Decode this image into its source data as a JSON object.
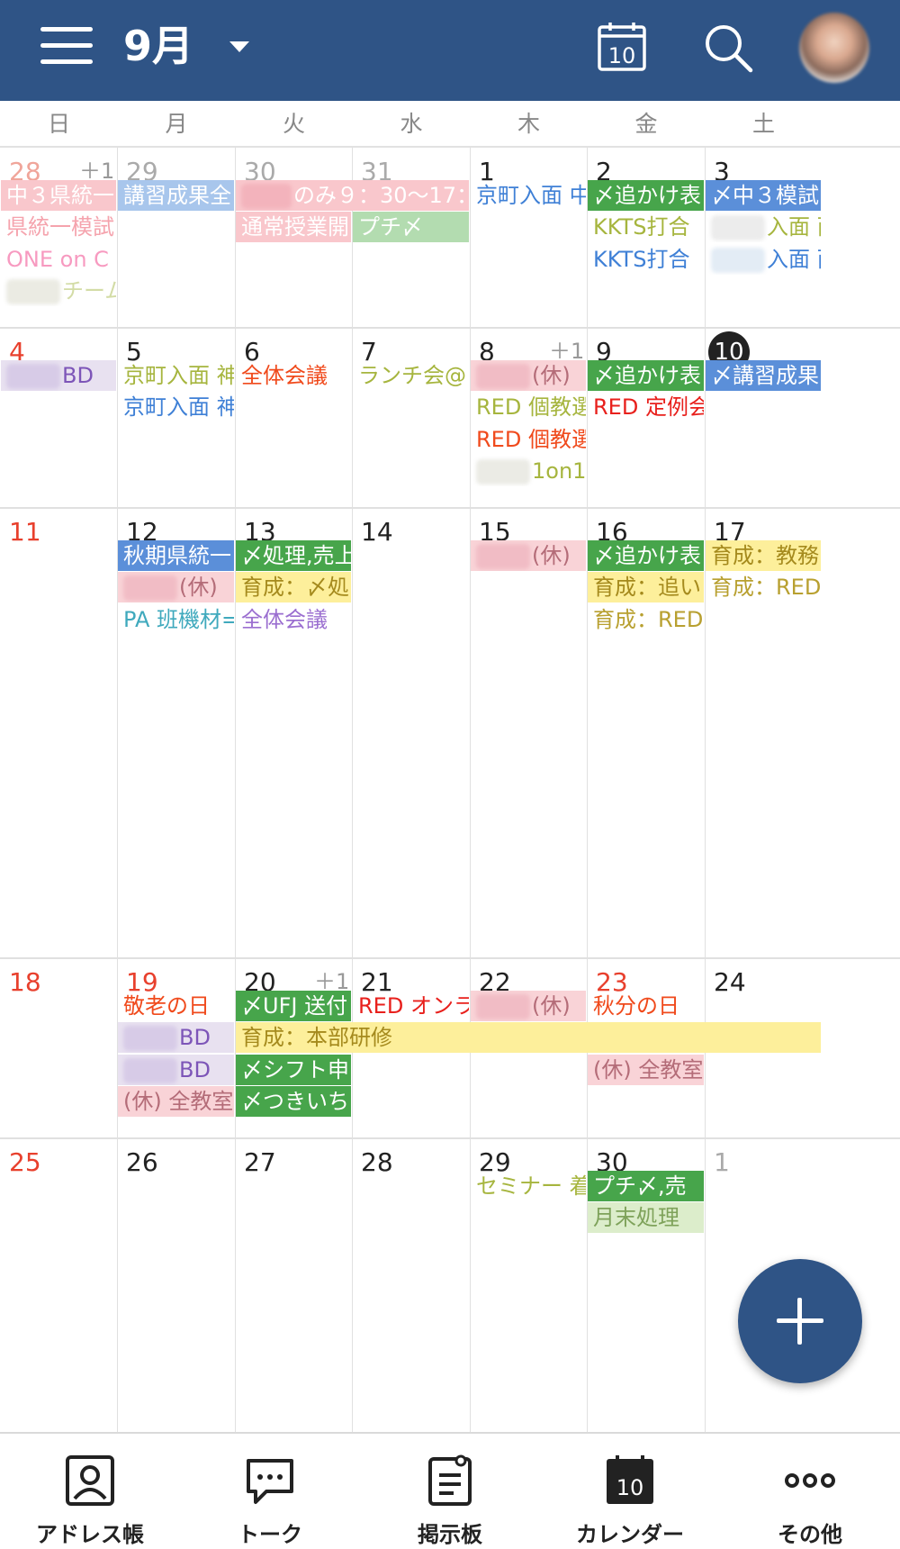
{
  "header": {
    "month": "9月",
    "today_icon_text": "10"
  },
  "weekdays": [
    "日",
    "月",
    "火",
    "水",
    "木",
    "金",
    "土"
  ],
  "weeks": [
    {
      "days": [
        {
          "n": "28",
          "muted": true,
          "red": true,
          "more": "＋1"
        },
        {
          "n": "29",
          "muted": true
        },
        {
          "n": "30",
          "muted": true
        },
        {
          "n": "31",
          "muted": true
        },
        {
          "n": "1"
        },
        {
          "n": "2"
        },
        {
          "n": "3"
        }
      ]
    },
    {
      "days": [
        {
          "n": "4",
          "red": true
        },
        {
          "n": "5"
        },
        {
          "n": "6"
        },
        {
          "n": "7"
        },
        {
          "n": "8",
          "more": "＋1"
        },
        {
          "n": "9"
        },
        {
          "n": "10",
          "today": true
        }
      ]
    },
    {
      "days": [
        {
          "n": "11",
          "red": true
        },
        {
          "n": "12"
        },
        {
          "n": "13"
        },
        {
          "n": "14"
        },
        {
          "n": "15"
        },
        {
          "n": "16"
        },
        {
          "n": "17"
        }
      ]
    },
    {
      "days": [
        {
          "n": "18",
          "red": true
        },
        {
          "n": "19",
          "red": true
        },
        {
          "n": "20",
          "more": "＋1"
        },
        {
          "n": "21"
        },
        {
          "n": "22"
        },
        {
          "n": "23",
          "red": true
        },
        {
          "n": "24"
        }
      ]
    },
    {
      "days": [
        {
          "n": "25",
          "red": true
        },
        {
          "n": "26"
        },
        {
          "n": "27"
        },
        {
          "n": "28"
        },
        {
          "n": "29"
        },
        {
          "n": "30"
        },
        {
          "n": "1",
          "muted": true
        }
      ]
    }
  ],
  "events": [
    {
      "w": 0,
      "c": 0,
      "span": 1,
      "row": 0,
      "text": "中３県統一",
      "bg": "#f9c7cc",
      "fg": "#ffffff"
    },
    {
      "w": 0,
      "c": 0,
      "span": 1,
      "row": 1,
      "text": "県統一模試",
      "bg": "",
      "fg": "#f5a3ad"
    },
    {
      "w": 0,
      "c": 0,
      "span": 1,
      "row": 2,
      "text": "ONE on C",
      "bg": "",
      "fg": "#f79ac0"
    },
    {
      "w": 0,
      "c": 0,
      "span": 1,
      "row": 3,
      "text": "チーム",
      "bg": "",
      "fg": "#d3dca6",
      "blur": "#ebebe3"
    },
    {
      "w": 0,
      "c": 1,
      "span": 1,
      "row": 0,
      "text": "講習成果全",
      "bg": "#a8c6ec",
      "fg": "#ffffff"
    },
    {
      "w": 0,
      "c": 2,
      "span": 2,
      "row": 0,
      "text": "のみ９：30～17：",
      "bg": "#f9c7cc",
      "fg": "#ffffff",
      "blur": "#f3b3bc"
    },
    {
      "w": 0,
      "c": 2,
      "span": 1,
      "row": 1,
      "text": "通常授業開",
      "bg": "#f9c7cc",
      "fg": "#ffffff"
    },
    {
      "w": 0,
      "c": 3,
      "span": 1,
      "row": 1,
      "text": "プチ〆",
      "bg": "#b3dcb0",
      "fg": "#ffffff"
    },
    {
      "w": 0,
      "c": 4,
      "span": 1,
      "row": 0,
      "text": "京町入面 中",
      "bg": "",
      "fg": "#3f80d6"
    },
    {
      "w": 0,
      "c": 5,
      "span": 1,
      "row": 0,
      "text": "〆追かけ表",
      "bg": "#47a54b",
      "fg": "#ffffff"
    },
    {
      "w": 0,
      "c": 5,
      "span": 1,
      "row": 1,
      "text": "KKTS打合",
      "bg": "",
      "fg": "#a6b53e"
    },
    {
      "w": 0,
      "c": 5,
      "span": 1,
      "row": 2,
      "text": "KKTS打合",
      "bg": "",
      "fg": "#3f80d6"
    },
    {
      "w": 0,
      "c": 6,
      "span": 1,
      "row": 0,
      "text": "〆中３模試",
      "bg": "#5b8fd9",
      "fg": "#ffffff"
    },
    {
      "w": 0,
      "c": 6,
      "span": 1,
      "row": 1,
      "text": "入面 西",
      "bg": "",
      "fg": "#a6b53e",
      "blur": "#ececec"
    },
    {
      "w": 0,
      "c": 6,
      "span": 1,
      "row": 2,
      "text": "入面 西",
      "bg": "",
      "fg": "#3f80d6",
      "blur": "#e3ecf5"
    },
    {
      "w": 1,
      "c": 0,
      "span": 1,
      "row": 0,
      "text": "BD",
      "bg": "#e8e1f0",
      "fg": "#7d55b8",
      "blur": "#d7cbe7"
    },
    {
      "w": 1,
      "c": 1,
      "span": 1,
      "row": 0,
      "text": "京町入面 神",
      "bg": "",
      "fg": "#a6b53e"
    },
    {
      "w": 1,
      "c": 1,
      "span": 1,
      "row": 1,
      "text": "京町入面 神",
      "bg": "",
      "fg": "#3f80d6"
    },
    {
      "w": 1,
      "c": 2,
      "span": 1,
      "row": 0,
      "text": "全体会議",
      "bg": "",
      "fg": "#f04a1c"
    },
    {
      "w": 1,
      "c": 3,
      "span": 1,
      "row": 0,
      "text": "ランチ会@",
      "bg": "",
      "fg": "#a6b53e"
    },
    {
      "w": 1,
      "c": 4,
      "span": 1,
      "row": 0,
      "text": "(休)",
      "bg": "#f9d3d7",
      "fg": "#b46c78",
      "blur": "#f1bcc5"
    },
    {
      "w": 1,
      "c": 4,
      "span": 1,
      "row": 1,
      "text": "RED 個教選",
      "bg": "",
      "fg": "#a6b53e"
    },
    {
      "w": 1,
      "c": 4,
      "span": 1,
      "row": 2,
      "text": "RED 個教選",
      "bg": "",
      "fg": "#f04a1c"
    },
    {
      "w": 1,
      "c": 4,
      "span": 1,
      "row": 3,
      "text": "1on1",
      "bg": "",
      "fg": "#a6b53e",
      "blur": "#ebebe5"
    },
    {
      "w": 1,
      "c": 5,
      "span": 1,
      "row": 0,
      "text": "〆追かけ表",
      "bg": "#47a54b",
      "fg": "#ffffff"
    },
    {
      "w": 1,
      "c": 5,
      "span": 1,
      "row": 1,
      "text": "RED 定例会",
      "bg": "",
      "fg": "#e8201c"
    },
    {
      "w": 1,
      "c": 6,
      "span": 1,
      "row": 0,
      "text": "〆講習成果",
      "bg": "#5b8fd9",
      "fg": "#ffffff"
    },
    {
      "w": 2,
      "c": 1,
      "span": 1,
      "row": 0,
      "text": "秋期県統一",
      "bg": "#5b8fd9",
      "fg": "#ffffff"
    },
    {
      "w": 2,
      "c": 1,
      "span": 1,
      "row": 1,
      "text": "(休)",
      "bg": "#f9d3d7",
      "fg": "#b46c78",
      "blur": "#f1bcc5"
    },
    {
      "w": 2,
      "c": 1,
      "span": 1,
      "row": 2,
      "text": "PA 班機材=",
      "bg": "",
      "fg": "#3fa9bd"
    },
    {
      "w": 2,
      "c": 2,
      "span": 1,
      "row": 0,
      "text": "〆処理,売上",
      "bg": "#47a54b",
      "fg": "#ffffff"
    },
    {
      "w": 2,
      "c": 2,
      "span": 1,
      "row": 1,
      "text": "育成：〆処",
      "bg": "#fdef9b",
      "fg": "#a58a1d"
    },
    {
      "w": 2,
      "c": 2,
      "span": 1,
      "row": 2,
      "text": "全体会議",
      "bg": "",
      "fg": "#9b6fd0"
    },
    {
      "w": 2,
      "c": 4,
      "span": 1,
      "row": 0,
      "text": "(休)",
      "bg": "#f9d3d7",
      "fg": "#b46c78",
      "blur": "#f1bcc5"
    },
    {
      "w": 2,
      "c": 5,
      "span": 1,
      "row": 0,
      "text": "〆追かけ表",
      "bg": "#47a54b",
      "fg": "#ffffff"
    },
    {
      "w": 2,
      "c": 5,
      "span": 1,
      "row": 1,
      "text": "育成：追い",
      "bg": "#fdef9b",
      "fg": "#a58a1d"
    },
    {
      "w": 2,
      "c": 5,
      "span": 1,
      "row": 2,
      "text": "育成：RED",
      "bg": "",
      "fg": "#b8a030"
    },
    {
      "w": 2,
      "c": 6,
      "span": 1,
      "row": 0,
      "text": "育成：教務",
      "bg": "#fdef9b",
      "fg": "#a58a1d"
    },
    {
      "w": 2,
      "c": 6,
      "span": 1,
      "row": 1,
      "text": "育成：RED",
      "bg": "",
      "fg": "#b8a030"
    },
    {
      "w": 3,
      "c": 1,
      "span": 1,
      "row": 0,
      "text": "敬老の日",
      "bg": "",
      "fg": "#f04a1c"
    },
    {
      "w": 3,
      "c": 1,
      "span": 1,
      "row": 1,
      "text": "BD",
      "bg": "#e8e1f0",
      "fg": "#7d55b8",
      "blur": "#d7cbe7"
    },
    {
      "w": 3,
      "c": 1,
      "span": 1,
      "row": 2,
      "text": "BD",
      "bg": "#e8e1f0",
      "fg": "#7d55b8",
      "blur": "#d7cbe7"
    },
    {
      "w": 3,
      "c": 1,
      "span": 1,
      "row": 3,
      "text": "(休) 全教室",
      "bg": "#f9d3d7",
      "fg": "#b46c78"
    },
    {
      "w": 3,
      "c": 2,
      "span": 1,
      "row": 0,
      "text": "〆UFJ 送付",
      "bg": "#47a54b",
      "fg": "#ffffff"
    },
    {
      "w": 3,
      "c": 2,
      "span": 5,
      "row": 1,
      "text": "育成：本部研修",
      "bg": "#fdef9b",
      "fg": "#a58a1d"
    },
    {
      "w": 3,
      "c": 2,
      "span": 1,
      "row": 2,
      "text": "〆シフト申",
      "bg": "#47a54b",
      "fg": "#ffffff"
    },
    {
      "w": 3,
      "c": 2,
      "span": 1,
      "row": 3,
      "text": "〆つきいち",
      "bg": "#47a54b",
      "fg": "#ffffff"
    },
    {
      "w": 3,
      "c": 3,
      "span": 1,
      "row": 0,
      "text": "RED オンラ",
      "bg": "",
      "fg": "#e8201c"
    },
    {
      "w": 3,
      "c": 4,
      "span": 1,
      "row": 0,
      "text": "(休)",
      "bg": "#f9d3d7",
      "fg": "#b46c78",
      "blur": "#f1bcc5"
    },
    {
      "w": 3,
      "c": 5,
      "span": 1,
      "row": 0,
      "text": "秋分の日",
      "bg": "",
      "fg": "#f04a1c"
    },
    {
      "w": 3,
      "c": 5,
      "span": 1,
      "row": 2,
      "text": "(休) 全教室",
      "bg": "#f9d3d7",
      "fg": "#b46c78"
    },
    {
      "w": 4,
      "c": 4,
      "span": 1,
      "row": 0,
      "text": "セミナー 着",
      "bg": "",
      "fg": "#a6b53e"
    },
    {
      "w": 4,
      "c": 5,
      "span": 1,
      "row": 0,
      "text": "プチ〆,売",
      "bg": "#47a54b",
      "fg": "#ffffff"
    },
    {
      "w": 4,
      "c": 5,
      "span": 1,
      "row": 1,
      "text": "月末処理",
      "bg": "#dcedcb",
      "fg": "#7ea25a"
    }
  ],
  "tabs": [
    {
      "label": "アドレス帳",
      "icon": "address-book-icon"
    },
    {
      "label": "トーク",
      "icon": "talk-bubble-icon"
    },
    {
      "label": "掲示板",
      "icon": "bulletin-board-icon"
    },
    {
      "label": "カレンダー",
      "icon": "calendar-icon",
      "icon_text": "10",
      "active": true
    },
    {
      "label": "その他",
      "icon": "more-dots-icon"
    }
  ],
  "colors": {
    "brand": "#2f5486",
    "holiday_red": "#e8402d"
  }
}
